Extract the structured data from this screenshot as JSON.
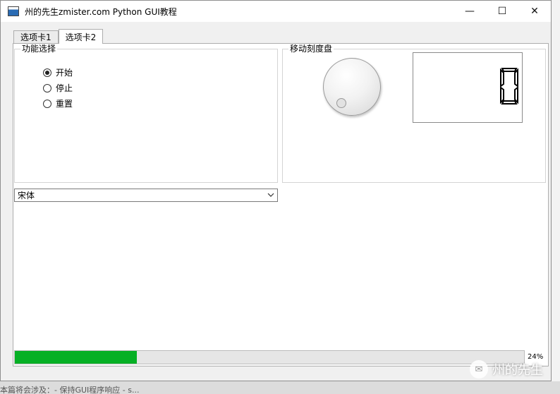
{
  "window": {
    "title": "州的先生zmister.com Python GUI教程",
    "minimize_glyph": "—",
    "maximize_glyph": "☐",
    "close_glyph": "✕"
  },
  "tabs": [
    {
      "label": "选项卡1",
      "active": false
    },
    {
      "label": "选项卡2",
      "active": true
    }
  ],
  "function_group": {
    "title": "功能选择",
    "options": [
      {
        "label": "开始",
        "checked": true
      },
      {
        "label": "停止",
        "checked": false
      },
      {
        "label": "重置",
        "checked": false
      }
    ]
  },
  "dial_group": {
    "title": "移动刻度盘",
    "dial_value": 0,
    "lcd_value": "0"
  },
  "font_combo": {
    "selected": "宋体"
  },
  "progress": {
    "value": 24,
    "label": "24%",
    "fill_color": "#06b025"
  },
  "background": {
    "partial_text": "本篇将会涉及：- 保持GUI程序响应 - s..."
  },
  "watermark": {
    "text": "州的先生"
  },
  "icons": [
    "app-icon",
    "minimize-icon",
    "maximize-icon",
    "close-icon",
    "chevron-down-icon",
    "wechat-icon"
  ]
}
